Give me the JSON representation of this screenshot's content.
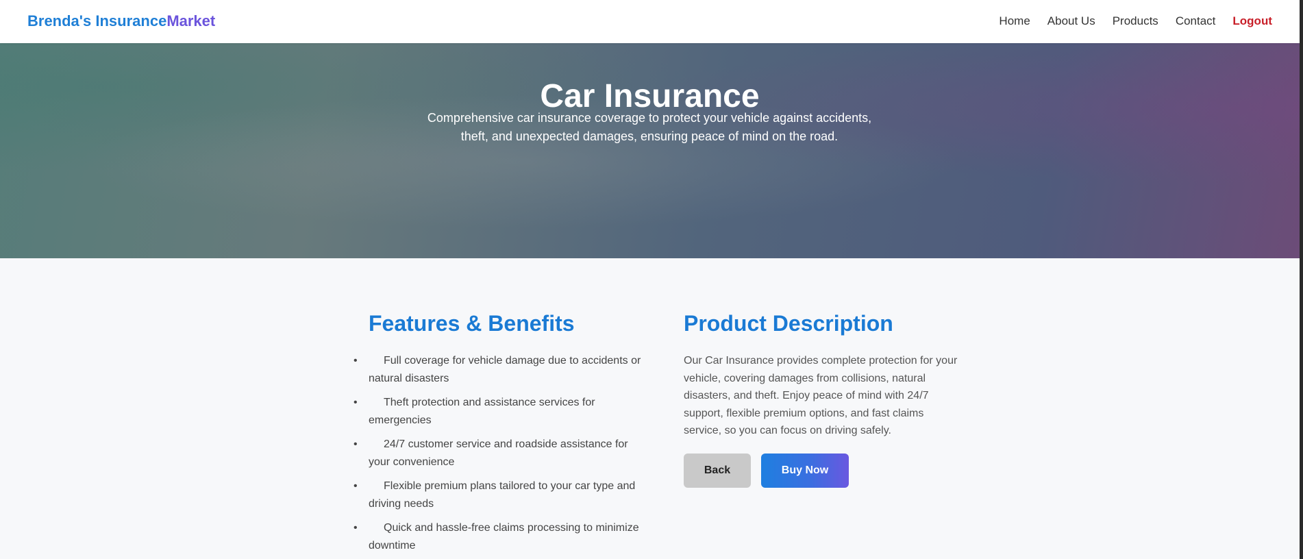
{
  "navbar": {
    "brand_part1": "Brenda's Insurance",
    "brand_part2": "Market",
    "links": [
      {
        "label": "Home"
      },
      {
        "label": "About Us"
      },
      {
        "label": "Products"
      },
      {
        "label": "Contact"
      },
      {
        "label": "Logout"
      }
    ]
  },
  "hero": {
    "title": "Car Insurance",
    "subtitle": "Comprehensive car insurance coverage to protect your vehicle against accidents, theft, and unexpected damages, ensuring peace of mind on the road."
  },
  "features": {
    "title": "Features & Benefits",
    "items": [
      "Full coverage for vehicle damage due to accidents or natural disasters",
      "Theft protection and assistance services for emergencies",
      "24/7 customer service and roadside assistance for your convenience",
      "Flexible premium plans tailored to your car type and driving needs",
      "Quick and hassle-free claims processing to minimize downtime"
    ]
  },
  "description": {
    "title": "Product Description",
    "text": "Our Car Insurance provides complete protection for your vehicle, covering damages from collisions, natural disasters, and theft. Enjoy peace of mind with 24/7 support, flexible premium options, and fast claims service, so you can focus on driving safely."
  },
  "actions": {
    "back_label": "Back",
    "buy_label": "Buy Now"
  },
  "colors": {
    "brand_blue": "#1f7fd6",
    "brand_purple": "#6b54dc",
    "logout_red": "#c81e28",
    "heading_blue": "#1a7ad4"
  }
}
